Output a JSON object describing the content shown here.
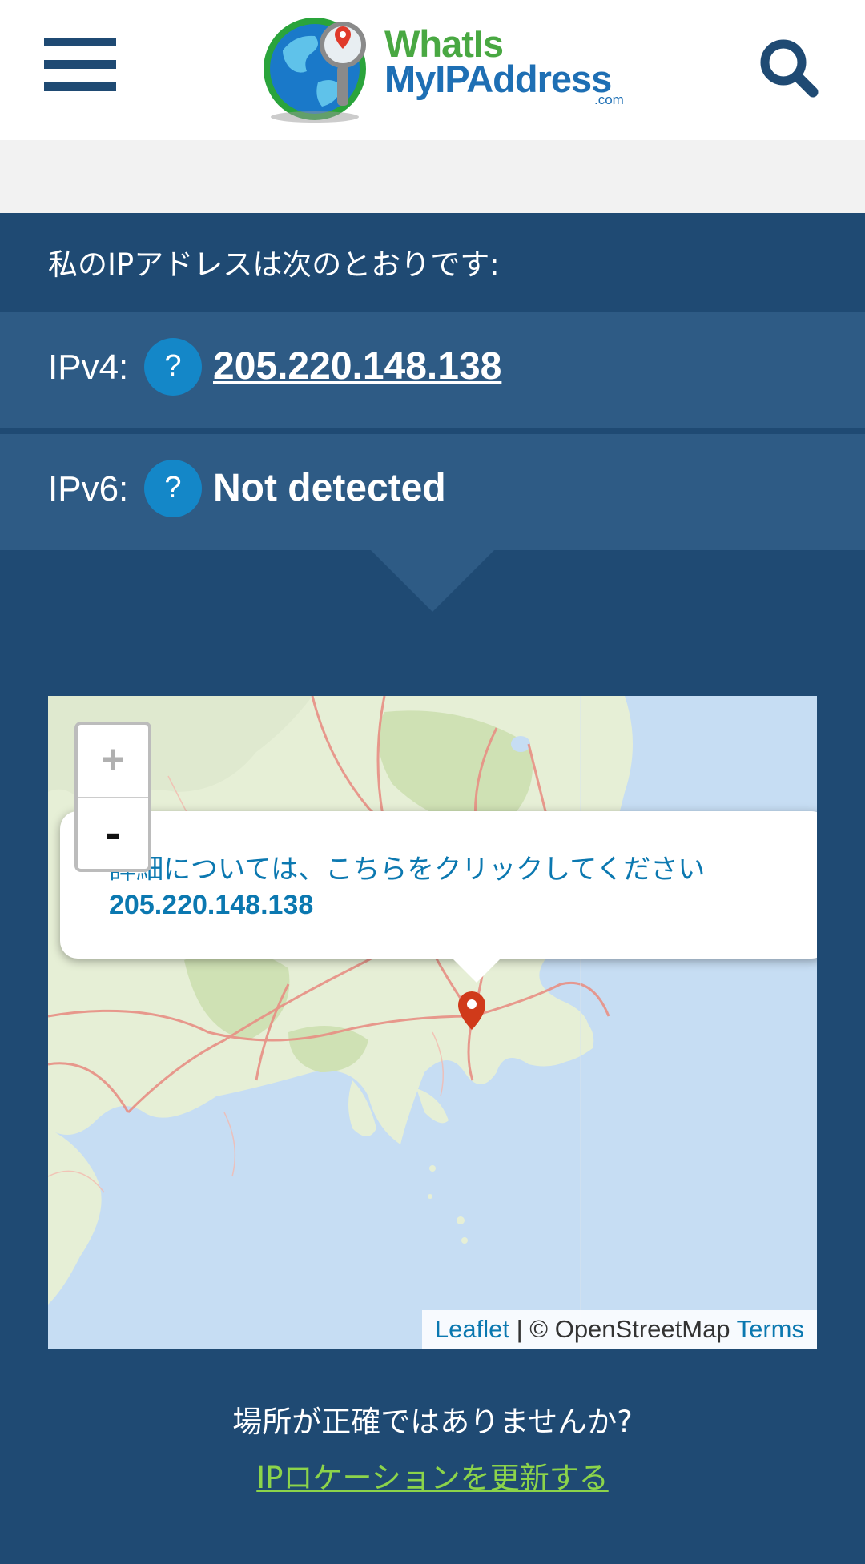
{
  "header": {
    "logo_line1": "WhatIs",
    "logo_line2": "MyIPAddress",
    "logo_line3": ".com"
  },
  "ip_section": {
    "heading": "私のIPアドレスは次のとおりです:",
    "ipv4_label": "IPv4:",
    "ipv4_help": "?",
    "ipv4_value": "205.220.148.138",
    "ipv6_label": "IPv6:",
    "ipv6_help": "?",
    "ipv6_value": "Not detected"
  },
  "map": {
    "zoom_in": "+",
    "zoom_out": "-",
    "popup_line1": "詳細については、こちらをクリックしてください",
    "popup_line2": "205.220.148.138",
    "attribution_leaflet": "Leaflet",
    "attribution_sep": " | © OpenStreetMap ",
    "attribution_terms": "Terms"
  },
  "location": {
    "question": "場所が正確ではありませんか?",
    "update_link": "IPロケーションを更新する"
  },
  "colors": {
    "header_bg": "#ffffff",
    "page_bg": "#1f4a73",
    "row_bg": "#2e5b85",
    "help_blue": "#1487c8",
    "link_green": "#8cd44a"
  }
}
